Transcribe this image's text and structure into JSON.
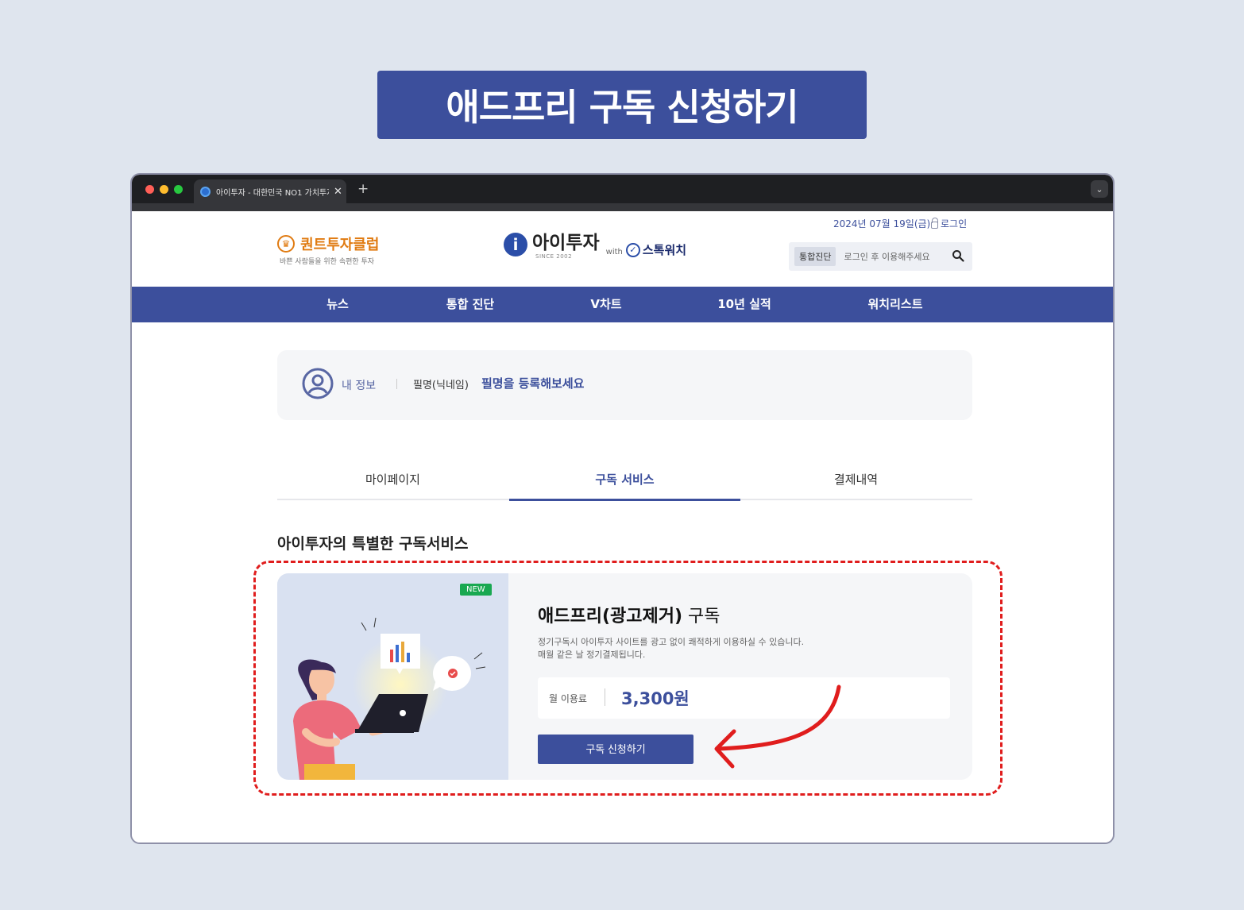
{
  "headline": "애드프리 구독 신청하기",
  "browser": {
    "tab_title": "아이투자 - 대한민국 NO1 가치투자",
    "tab_close": "✕",
    "new_tab": "+",
    "dropdown": "⌄"
  },
  "header": {
    "date": "2024년 07월 19일(금)",
    "login": "로그인",
    "quant_logo": "퀀트투자클럽",
    "quant_tagline": "바쁜 사람들을 위한 속편한 투자",
    "logo_mark": "i",
    "logo_name": "아이투자",
    "logo_since": "SINCE 2002",
    "with": "with",
    "partner": "스톡워치",
    "search_tag": "통합진단",
    "search_placeholder": "로그인 후 이용해주세요"
  },
  "nav": {
    "items": [
      {
        "label": "뉴스"
      },
      {
        "label": "통합 진단"
      },
      {
        "label": "V차트"
      },
      {
        "label": "10년 실적"
      },
      {
        "label": "워치리스트"
      }
    ]
  },
  "profile": {
    "label": "내 정보",
    "nick_label": "필명(닉네임)",
    "nick_cta": "필명을 등록해보세요"
  },
  "tabs": [
    {
      "label": "마이페이지"
    },
    {
      "label": "구독 서비스"
    },
    {
      "label": "결제내역"
    }
  ],
  "section_title": "아이투자의 특별한 구독서비스",
  "subscription": {
    "badge": "NEW",
    "title_bold": "애드프리(광고제거)",
    "title_rest": " 구독",
    "desc_line1": "정기구독시 아이투자 사이트를 광고 없이 쾌적하게 이용하실 수 있습니다.",
    "desc_line2": "매월 같은 날 정기결제됩니다.",
    "price_label": "월 이용료",
    "price_value": "3,300원",
    "button": "구독 신청하기"
  },
  "colors": {
    "brand": "#3c4f9c",
    "accent_orange": "#e07b12",
    "annotation_red": "#e01d1d",
    "new_badge": "#19a851"
  }
}
